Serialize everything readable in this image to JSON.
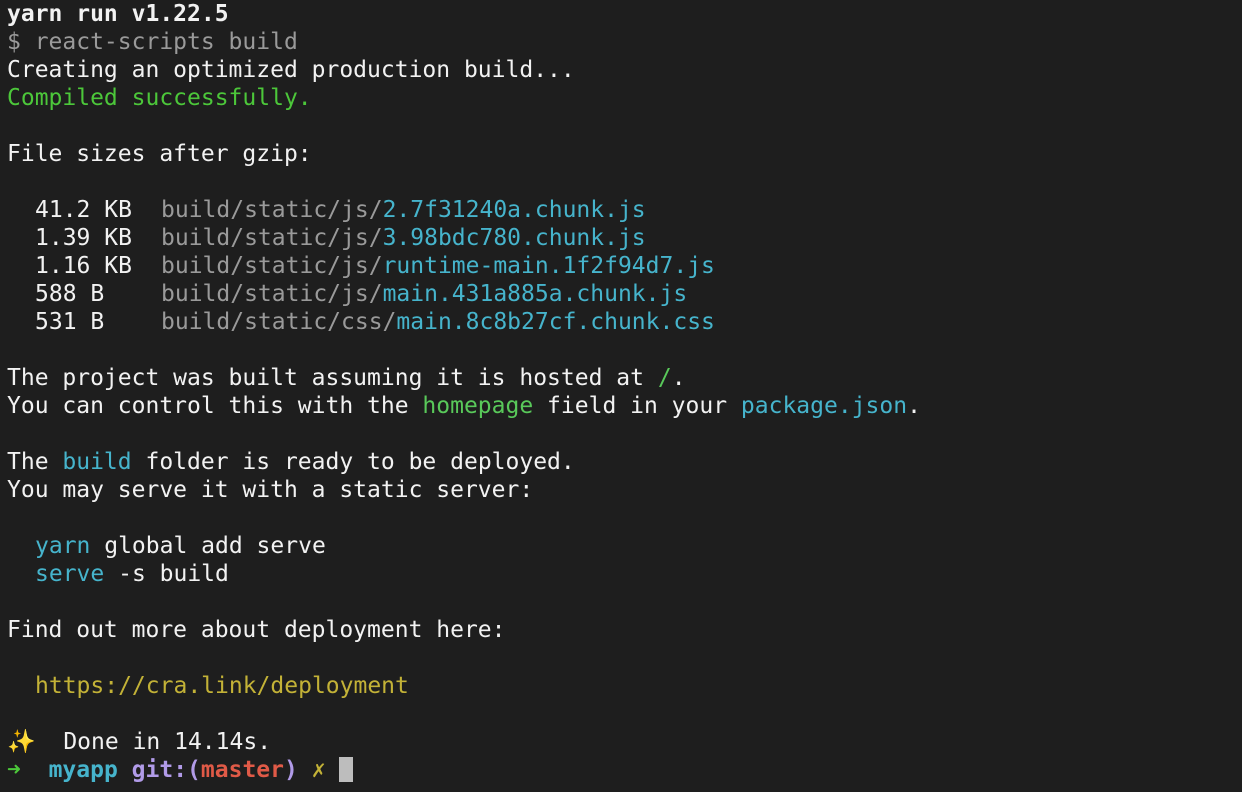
{
  "terminal": {
    "yarn_header": "yarn run v1.22.5",
    "command": "$ react-scripts build",
    "creating": "Creating an optimized production build...",
    "compiled": "Compiled successfully.",
    "sizes_heading": "File sizes after gzip:",
    "files": [
      {
        "size": "41.2 KB",
        "dir": "build/static/js/",
        "name": "2.7f31240a.chunk.js"
      },
      {
        "size": "1.39 KB",
        "dir": "build/static/js/",
        "name": "3.98bdc780.chunk.js"
      },
      {
        "size": "1.16 KB",
        "dir": "build/static/js/",
        "name": "runtime-main.1f2f94d7.js"
      },
      {
        "size": "588 B",
        "dir": "build/static/js/",
        "name": "main.431a885a.chunk.js"
      },
      {
        "size": "531 B",
        "dir": "build/static/css/",
        "name": "main.8c8b27cf.chunk.css"
      }
    ],
    "hosted_prefix": "The project was built assuming it is hosted at ",
    "hosted_path": "/",
    "hosted_suffix": ".",
    "control_prefix": "You can control this with the ",
    "control_field": "homepage",
    "control_middle": " field in your ",
    "control_file": "package.json",
    "control_suffix": ".",
    "folder_prefix": "The ",
    "folder_name": "build",
    "folder_suffix": " folder is ready to be deployed.",
    "serve_intro": "You may serve it with a static server:",
    "cmd1_tool": "yarn",
    "cmd1_rest": " global add serve",
    "cmd2_tool": "serve",
    "cmd2_rest": " -s build",
    "more_info": "Find out more about deployment here:",
    "url": "https://cra.link/deployment",
    "sparkle": "✨",
    "done": "  Done in 14.14s."
  },
  "prompt": {
    "arrow": "➜",
    "dir": "myapp",
    "git_label": "git:(",
    "branch": "master",
    "git_close": ")",
    "dirty_mark": "✗"
  },
  "colors": {
    "background": "#1e1e1e",
    "success_green": "#4cc73a",
    "link_cyan": "#46b4cc",
    "url_yellow": "#c3b237",
    "branch_red": "#e05a47"
  }
}
